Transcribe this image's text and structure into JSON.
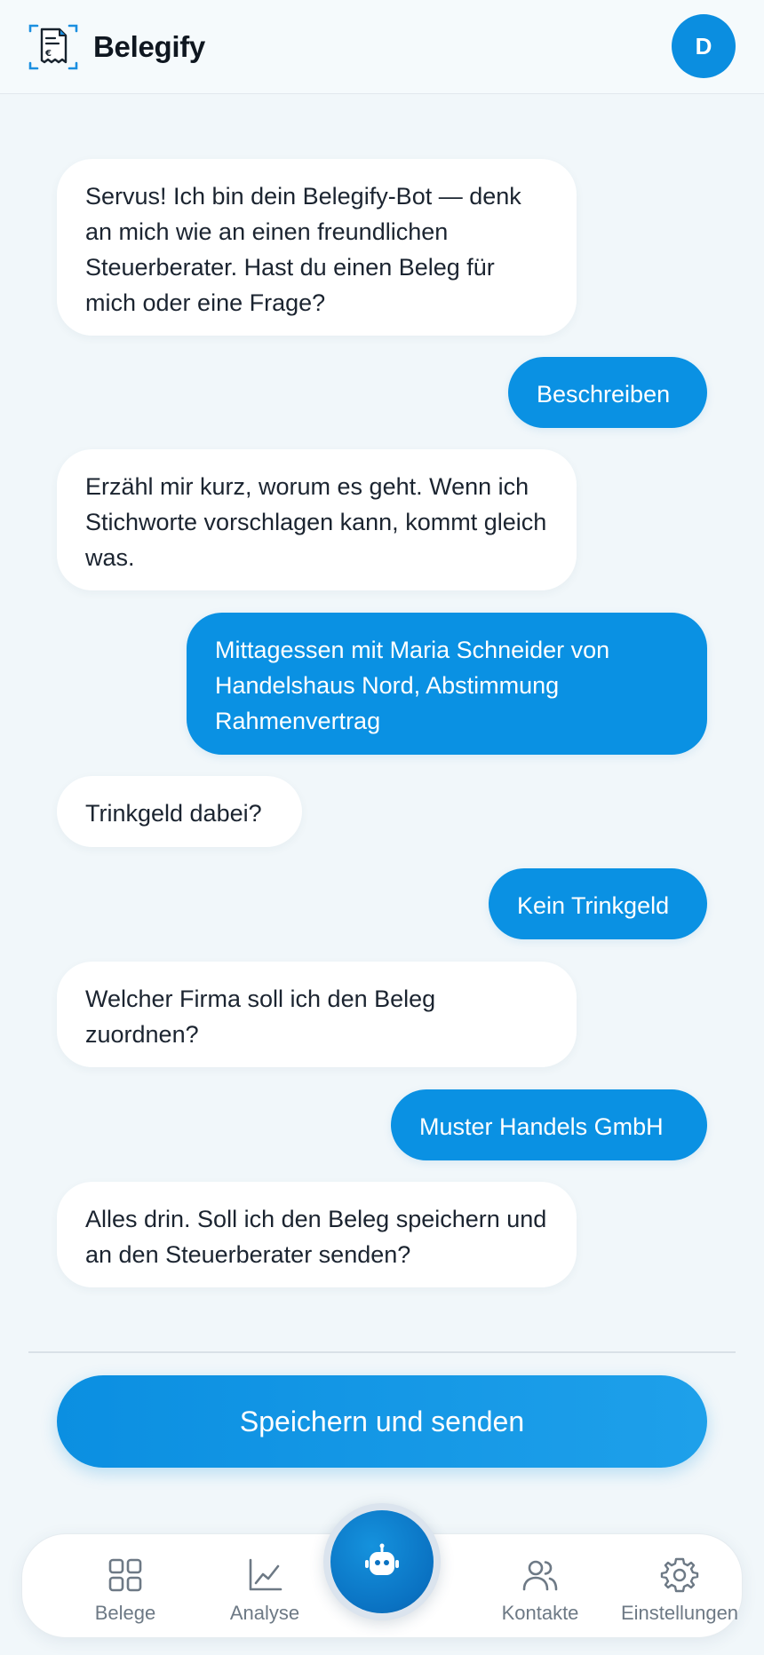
{
  "app": {
    "name": "Belegify",
    "avatar_initial": "D",
    "accent_color": "#0a91e3"
  },
  "chat": {
    "messages": [
      {
        "from": "bot",
        "text": "Servus! Ich bin dein Belegify-Bot — denk an mich wie an einen freundlichen Steuerberater. Hast du einen Beleg für mich oder eine Frage?"
      },
      {
        "from": "user",
        "text": "Beschreiben"
      },
      {
        "from": "bot",
        "text": "Erzähl mir kurz, worum es geht. Wenn ich Stichworte vorschlagen kann, kommt gleich was."
      },
      {
        "from": "user",
        "text": "Mittagessen mit Maria Schneider von Handelshaus Nord, Abstimmung Rahmenvertrag"
      },
      {
        "from": "bot",
        "text": "Trinkgeld dabei?"
      },
      {
        "from": "user",
        "text": "Kein Trinkgeld"
      },
      {
        "from": "bot",
        "text": "Welcher Firma soll ich den Beleg zuordnen?"
      },
      {
        "from": "user",
        "text": "Muster Handels GmbH"
      },
      {
        "from": "bot",
        "text": "Alles drin. Soll ich den Beleg speichern und an den Steuerberater senden?"
      }
    ]
  },
  "actions": {
    "save_and_send_label": "Speichern und senden"
  },
  "nav": {
    "items": [
      {
        "label": "Belege",
        "icon": "grid-icon"
      },
      {
        "label": "Analyse",
        "icon": "chart-icon"
      },
      {
        "label": "",
        "icon": "bot-icon"
      },
      {
        "label": "Kontakte",
        "icon": "users-icon"
      },
      {
        "label": "Einstellungen",
        "icon": "gear-icon"
      }
    ]
  }
}
